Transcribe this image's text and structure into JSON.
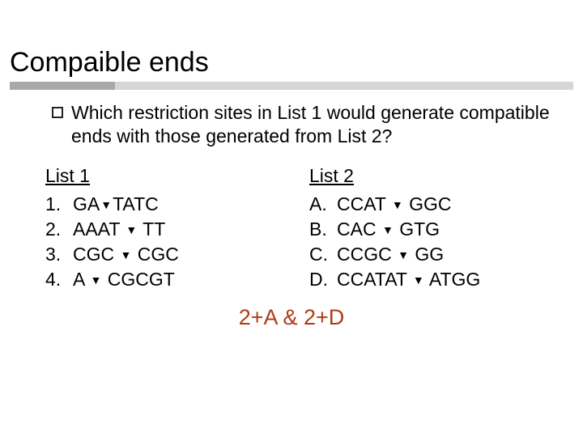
{
  "title": "Compaible ends",
  "question": "Which restriction sites in List 1 would generate compatible ends with those generated from List 2?",
  "mark": "▼",
  "list1": {
    "heading": "List 1",
    "items": [
      {
        "n": "1.",
        "pre": "GA",
        "post": "TATC"
      },
      {
        "n": "2.",
        "pre": "AAAT ",
        "post": " TT"
      },
      {
        "n": "3.",
        "pre": "CGC ",
        "post": " CGC"
      },
      {
        "n": "4.",
        "pre": "A ",
        "post": " CGCGT"
      }
    ]
  },
  "list2": {
    "heading": "List 2",
    "items": [
      {
        "n": "A.",
        "pre": "CCAT ",
        "post": " GGC"
      },
      {
        "n": "B.",
        "pre": "CAC ",
        "post": " GTG"
      },
      {
        "n": "C.",
        "pre": "CCGC ",
        "post": " GG"
      },
      {
        "n": "D.",
        "pre": "CCATAT ",
        "post": " ATGG"
      }
    ]
  },
  "answer": "2+A & 2+D"
}
